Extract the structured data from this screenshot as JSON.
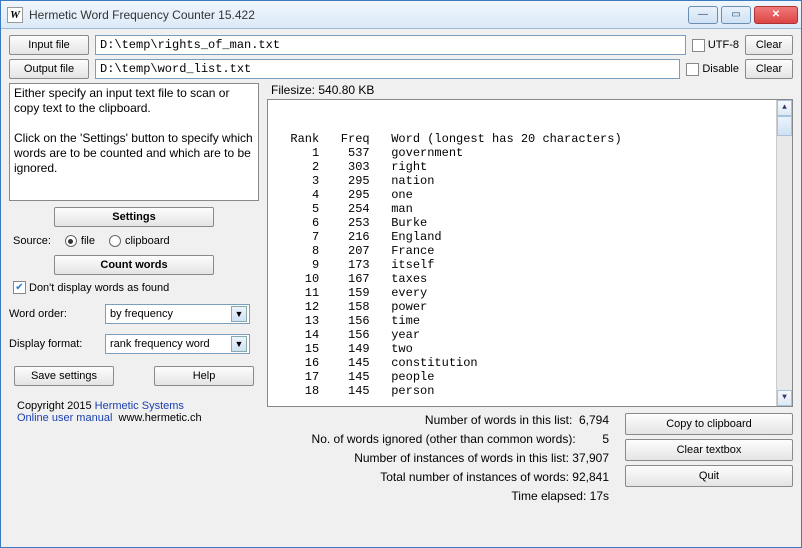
{
  "window": {
    "title": "Hermetic Word Frequency Counter 15.422",
    "icon_letter": "W"
  },
  "toolbar": {
    "input_file_label": "Input file",
    "output_file_label": "Output file",
    "input_value": "D:\\temp\\rights_of_man.txt",
    "output_value": "D:\\temp\\word_list.txt",
    "utf8_label": "UTF-8",
    "disable_label": "Disable",
    "clear_label": "Clear"
  },
  "info_text": "Either specify an input text file to scan or copy text to the clipboard.\n\nClick on the 'Settings' button to specify which words are to be counted and which are to be ignored.",
  "buttons": {
    "settings": "Settings",
    "count_words": "Count words",
    "save_settings": "Save settings",
    "help": "Help",
    "copy_clipboard": "Copy to clipboard",
    "clear_textbox": "Clear textbox",
    "quit": "Quit"
  },
  "source": {
    "label": "Source:",
    "file": "file",
    "clipboard": "clipboard",
    "selected": "file"
  },
  "dont_display": {
    "label": "Don't display words as found",
    "checked": true
  },
  "word_order": {
    "label": "Word order:",
    "value": "by frequency"
  },
  "display_format": {
    "label": "Display format:",
    "value": "rank frequency word"
  },
  "copyright": {
    "text": "Copyright 2015",
    "company": "Hermetic Systems",
    "manual": "Online user manual",
    "site": "www.hermetic.ch"
  },
  "filesize_label": "Filesize: 540.80 KB",
  "results": {
    "header_rank": "Rank",
    "header_freq": "Freq",
    "header_word": "Word (longest has 20 characters)",
    "rows": [
      {
        "rank": 1,
        "freq": 537,
        "word": "government"
      },
      {
        "rank": 2,
        "freq": 303,
        "word": "right"
      },
      {
        "rank": 3,
        "freq": 295,
        "word": "nation"
      },
      {
        "rank": 4,
        "freq": 295,
        "word": "one"
      },
      {
        "rank": 5,
        "freq": 254,
        "word": "man"
      },
      {
        "rank": 6,
        "freq": 253,
        "word": "Burke"
      },
      {
        "rank": 7,
        "freq": 216,
        "word": "England"
      },
      {
        "rank": 8,
        "freq": 207,
        "word": "France"
      },
      {
        "rank": 9,
        "freq": 173,
        "word": "itself"
      },
      {
        "rank": 10,
        "freq": 167,
        "word": "taxes"
      },
      {
        "rank": 11,
        "freq": 159,
        "word": "every"
      },
      {
        "rank": 12,
        "freq": 158,
        "word": "power"
      },
      {
        "rank": 13,
        "freq": 156,
        "word": "time"
      },
      {
        "rank": 14,
        "freq": 156,
        "word": "year"
      },
      {
        "rank": 15,
        "freq": 149,
        "word": "two"
      },
      {
        "rank": 16,
        "freq": 145,
        "word": "constitution"
      },
      {
        "rank": 17,
        "freq": 145,
        "word": "people"
      },
      {
        "rank": 18,
        "freq": 145,
        "word": "person"
      }
    ]
  },
  "stats": {
    "words_in_list": "Number of words in this list:  6,794",
    "ignored": "No. of words ignored (other than common words):        5",
    "instances_in_list": "Number of instances of words in this list: 37,907",
    "total_instances": "Total number of instances of words: 92,841",
    "time_elapsed": "Time elapsed: 17s"
  }
}
